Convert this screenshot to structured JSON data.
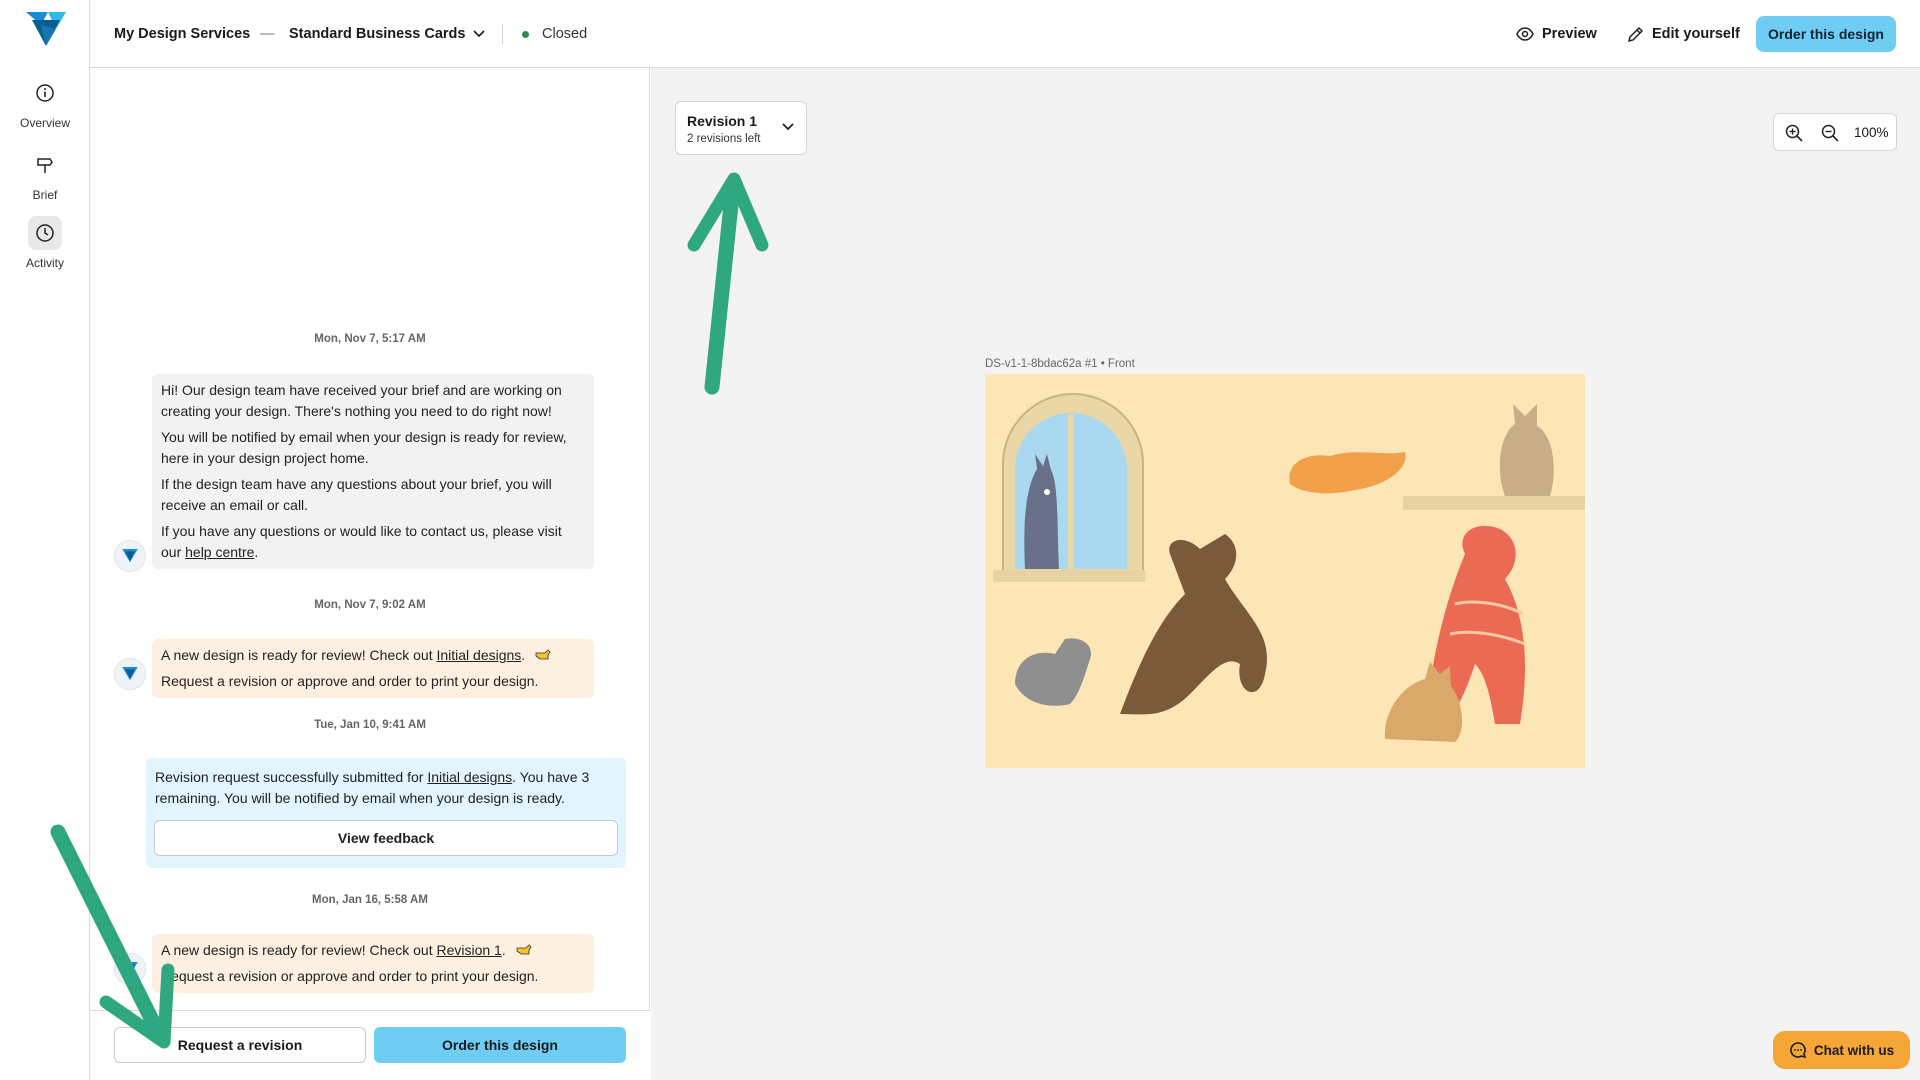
{
  "rail": {
    "items": [
      {
        "label": "Overview",
        "icon": "info-icon"
      },
      {
        "label": "Brief",
        "icon": "signpost-icon"
      },
      {
        "label": "Activity",
        "icon": "clock-icon"
      }
    ]
  },
  "header": {
    "breadcrumb_root": "My Design Services",
    "separator": "—",
    "project": "Standard Business Cards",
    "status": "Closed",
    "preview_label": "Preview",
    "edit_label": "Edit yourself",
    "order_label": "Order this design"
  },
  "chat": {
    "messages": [
      {
        "timestamp": "Mon, Nov 7, 5:17 AM",
        "p1": "Hi! Our design team have received your brief and are working on creating your design. There's nothing you need to do right now!",
        "p2": "You will be notified by email when your design is ready for review, here in your design project home.",
        "p3": "If the design team have any questions about your brief, you will receive an email or call.",
        "p4_pre": "If you have any questions or would like to contact us, please visit our ",
        "p4_link": "help centre",
        "p4_post": "."
      },
      {
        "timestamp": "Mon, Nov 7, 9:02 AM",
        "pre": "A new design is ready for review! Check out ",
        "link": "Initial designs",
        "post": ".",
        "line2": "Request a revision or approve and order to print your design."
      },
      {
        "timestamp": "Tue, Jan 10, 9:41 AM",
        "pre": "Revision request successfully submitted for ",
        "link": "Initial designs",
        "post": ". You have 3 remaining. You will be notified by email when your design is ready.",
        "button": "View feedback"
      },
      {
        "timestamp": "Mon, Jan 16, 5:58 AM",
        "pre": "A new design is ready for review! Check out ",
        "link": "Revision 1",
        "post": ".",
        "line2": "Request a revision or approve and order to print your design."
      }
    ],
    "footer": {
      "request_revision": "Request a revision",
      "order": "Order this design"
    }
  },
  "canvas": {
    "revision_title": "Revision 1",
    "revision_sub": "2 revisions left",
    "zoom_value": "100%",
    "design_caption": "DS-v1-1-8bdac62a #1 • Front"
  },
  "chat_widget": {
    "label": "Chat with us"
  },
  "colors": {
    "accent": "#6fcdf3",
    "status_dot": "#2f8a4a",
    "chat_widget": "#f4a637",
    "annotation_arrow": "#2fa882",
    "design_bg": "#fde6b6"
  }
}
